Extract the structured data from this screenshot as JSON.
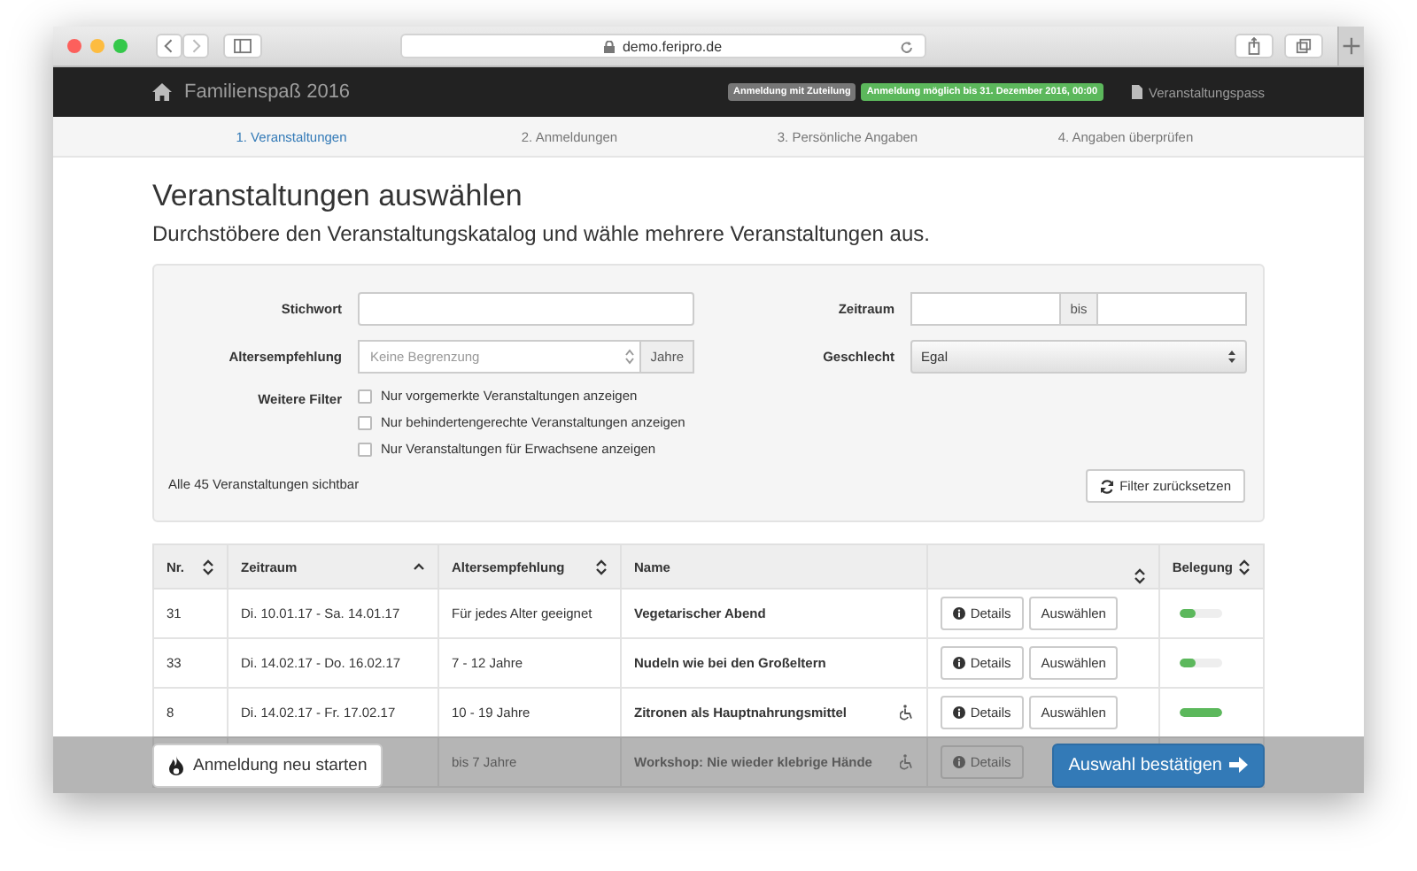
{
  "browser": {
    "url": "demo.feripro.de"
  },
  "navbar": {
    "brand": "Familienspaß 2016",
    "badges": [
      {
        "label": "Anmeldung mit Zuteilung",
        "kind": "info"
      },
      {
        "label": "Anmeldung möglich bis 31. Dezember 2016, 00:00",
        "kind": "success"
      }
    ],
    "pass_link": "Veranstaltungspass"
  },
  "steps": [
    {
      "label": "1. Veranstaltungen",
      "selected": true
    },
    {
      "label": "2. Anmeldungen",
      "selected": false
    },
    {
      "label": "3. Persönliche Angaben",
      "selected": false
    },
    {
      "label": "4. Angaben überprüfen",
      "selected": false
    }
  ],
  "heading": "Veranstaltungen auswählen",
  "subtitle": "Durchstöbere den Veranstaltungskatalog und wähle mehrere Veranstaltungen aus.",
  "filters": {
    "keyword_label": "Stichwort",
    "period_label": "Zeitraum",
    "period_separator": "bis",
    "age_label": "Altersempfehlung",
    "age_placeholder": "Keine Begrenzung",
    "age_unit": "Jahre",
    "gender_label": "Geschlecht",
    "gender_value": "Egal",
    "more_label": "Weitere Filter",
    "checkboxes": [
      {
        "label": "Nur vorgemerkte Veranstaltungen anzeigen",
        "checked": false
      },
      {
        "label": "Nur behindertengerechte Veranstaltungen anzeigen",
        "checked": false
      },
      {
        "label": "Nur Veranstaltungen für Erwachsene anzeigen",
        "checked": false
      }
    ],
    "count_text": "Alle 45 Veranstaltungen sichtbar",
    "reset_button": "Filter zurücksetzen"
  },
  "table": {
    "columns": [
      {
        "label": "Nr.",
        "sortable": true,
        "sorted_ascending": false
      },
      {
        "label": "Zeitraum",
        "sortable": true,
        "sorted_ascending": true
      },
      {
        "label": "Altersempfehlung",
        "sortable": true,
        "sorted_ascending": false
      },
      {
        "label": "Name",
        "sortable": false
      },
      {
        "sortable": true,
        "sorted_ascending": false
      },
      {
        "label": "Belegung",
        "sortable": true,
        "sorted_ascending": false
      }
    ],
    "rows": [
      {
        "nr": "31",
        "zeitraum": "Di. 10.01.17 - Sa. 14.01.17",
        "alter": "Für jedes Alter geeignet",
        "name": "Vegetarischer Abend",
        "accessible": false,
        "details": "Details",
        "select": "Auswählen",
        "level": 0.4
      },
      {
        "nr": "33",
        "zeitraum": "Di. 14.02.17 - Do. 16.02.17",
        "alter": "7 - 12 Jahre",
        "name": "Nudeln wie bei den Großeltern",
        "accessible": false,
        "details": "Details",
        "select": "Auswählen",
        "level": 0.4
      },
      {
        "nr": "8",
        "zeitraum": "Di. 14.02.17 - Fr. 17.02.17",
        "alter": "10 - 19 Jahre",
        "name": "Zitronen als Hauptnahrungsmittel",
        "accessible": true,
        "details": "Details",
        "select": "Auswählen",
        "level": 1
      },
      {
        "alter": "bis 7 Jahre",
        "name": "Workshop: Nie wieder klebrige Hände",
        "accessible": true,
        "details": "Details"
      }
    ]
  },
  "footer": {
    "restart_button": "Anmeldung neu starten",
    "confirm_button": "Auswahl bestätigen"
  }
}
